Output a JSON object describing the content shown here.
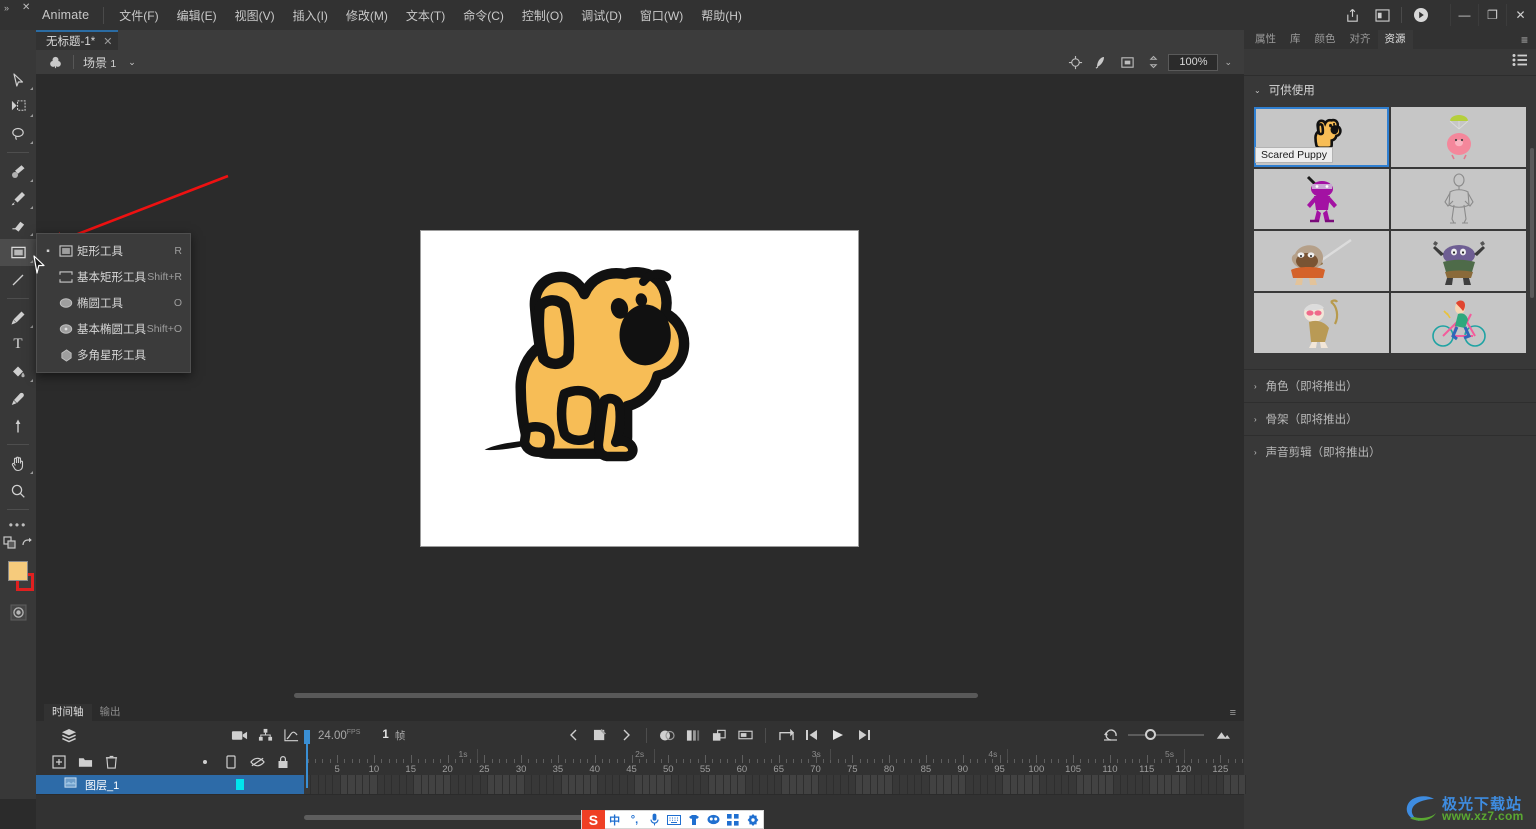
{
  "titlebar": {
    "app_name": "Animate",
    "menus": [
      "文件(F)",
      "编辑(E)",
      "视图(V)",
      "插入(I)",
      "修改(M)",
      "文本(T)",
      "命令(C)",
      "控制(O)",
      "调试(D)",
      "窗口(W)",
      "帮助(H)"
    ],
    "share_icon": "share-icon",
    "workspace_icon": "workspace-layout-icon",
    "play_icon": "play-preview-icon",
    "minimize": "—",
    "maximize": "❐",
    "close": "✕"
  },
  "document": {
    "tab_title": "无标题-1*",
    "tab_close": "✕"
  },
  "editbar": {
    "scene_icon": "scene-icon",
    "scene_label": "场景",
    "scene_number": "1",
    "caret": "⌄",
    "center_icon": "center-stage-icon",
    "rotate_icon": "rotate-stage-icon",
    "clip_icon": "clip-content-icon",
    "stepper_icon": "stage-stepper-icon",
    "zoom_value": "100%",
    "zoom_caret": "⌄"
  },
  "toolbar": {
    "tools": [
      {
        "name": "selection-tool",
        "glyph": "arrow"
      },
      {
        "name": "free-transform-tool",
        "glyph": "transform"
      },
      {
        "name": "lasso-tool",
        "glyph": "lasso"
      },
      {
        "name": "paintbrush-tool",
        "glyph": "brush-fluid"
      },
      {
        "name": "brush-tool",
        "glyph": "brush"
      },
      {
        "name": "eraser-tool",
        "glyph": "eraser"
      },
      {
        "name": "rectangle-tool",
        "glyph": "rectangle"
      },
      {
        "name": "line-tool",
        "glyph": "line"
      },
      {
        "name": "pen-tool",
        "glyph": "pen"
      },
      {
        "name": "text-tool",
        "glyph": "T"
      },
      {
        "name": "paint-bucket-tool",
        "glyph": "bucket"
      },
      {
        "name": "eyedropper-tool",
        "glyph": "eyedropper"
      },
      {
        "name": "width-tool",
        "glyph": "pin"
      },
      {
        "name": "hand-tool",
        "glyph": "hand"
      },
      {
        "name": "zoom-tool",
        "glyph": "magnifier"
      }
    ],
    "more_dots": "•••",
    "swap_colors_icon": "swap-colors-icon",
    "reset_colors_icon": "reset-colors-icon",
    "fill_color": "#f6cb7c",
    "stroke_color": "#e02020",
    "object_draw_icon": "object-drawing-icon"
  },
  "tool_menu": {
    "items": [
      {
        "label": "矩形工具",
        "key": "R",
        "icon": "rectangle-icon",
        "selected": true
      },
      {
        "label": "基本矩形工具",
        "key": "Shift+R",
        "icon": "primitive-rectangle-icon",
        "selected": false
      },
      {
        "label": "椭圆工具",
        "key": "O",
        "icon": "oval-icon",
        "selected": false
      },
      {
        "label": "基本椭圆工具",
        "key": "Shift+O",
        "icon": "primitive-oval-icon",
        "selected": false
      },
      {
        "label": "多角星形工具",
        "key": "",
        "icon": "polystar-icon",
        "selected": false
      }
    ]
  },
  "rightpanel": {
    "tabs": [
      {
        "label": "属性",
        "active": false
      },
      {
        "label": "库",
        "active": false
      },
      {
        "label": "颜色",
        "active": false
      },
      {
        "label": "对齐",
        "active": false
      },
      {
        "label": "资源",
        "active": true
      }
    ],
    "panel_menu_icon": "panel-menu-icon",
    "list_view_icon": "list-view-icon",
    "available_section": {
      "caret": "⌄",
      "title": "可供使用"
    },
    "assets": [
      {
        "name": "Scared Puppy",
        "kind": "puppy",
        "selected": true,
        "tooltip": "Scared Puppy"
      },
      {
        "name": "parachute-pig",
        "kind": "pig",
        "selected": false,
        "tooltip": ""
      },
      {
        "name": "purple-ninja",
        "kind": "ninja",
        "selected": false,
        "tooltip": ""
      },
      {
        "name": "wireframe-figure",
        "kind": "wire",
        "selected": false,
        "tooltip": ""
      },
      {
        "name": "sword-warrior",
        "kind": "warrior",
        "selected": false,
        "tooltip": ""
      },
      {
        "name": "gun-creature",
        "kind": "creature",
        "selected": false,
        "tooltip": ""
      },
      {
        "name": "golf-grandpa",
        "kind": "golfer",
        "selected": false,
        "tooltip": ""
      },
      {
        "name": "cyclist-girl",
        "kind": "cyclist",
        "selected": false,
        "tooltip": ""
      }
    ],
    "coming_soon": [
      {
        "caret": "›",
        "label": "角色（即将推出）"
      },
      {
        "caret": "›",
        "label": "骨架（即将推出）"
      },
      {
        "caret": "›",
        "label": "声音剪辑（即将推出）"
      }
    ]
  },
  "timeline": {
    "tabs": [
      {
        "label": "时间轴",
        "active": true
      },
      {
        "label": "输出",
        "active": false
      }
    ],
    "panel_menu_icon": "timeline-menu-icon",
    "layers_icon": "layers-stack-icon",
    "camera_icon": "camera-icon",
    "parent_view_icon": "parent-view-icon",
    "graph_icon": "graph-editor-icon",
    "fps_value": "24.00",
    "fps_unit": "FPS",
    "current_frame": "1",
    "frame_unit": "帧",
    "controls": [
      {
        "name": "prev-keyframe-button",
        "glyph": "‹"
      },
      {
        "name": "insert-keyframe-button",
        "glyph": "kf"
      },
      {
        "name": "next-keyframe-button",
        "glyph": "›"
      },
      {
        "name": "onion-skin-button",
        "glyph": "onion"
      },
      {
        "name": "onion-skin-outlines-button",
        "glyph": "onion-outline"
      },
      {
        "name": "edit-multiple-frames-button",
        "glyph": "multi"
      },
      {
        "name": "modify-onion-markers-button",
        "glyph": "markers"
      },
      {
        "name": "loop-range-button",
        "glyph": "loop-range"
      },
      {
        "name": "step-back-button",
        "glyph": "◀|"
      },
      {
        "name": "play-button",
        "glyph": "▶"
      },
      {
        "name": "step-forward-button",
        "glyph": "|▶"
      }
    ],
    "loop_icon": "loop-playback-icon",
    "resize_icon": "resize-frames-icon",
    "add_layer_icon": "add-layer-icon",
    "add_folder_icon": "new-folder-icon",
    "delete_layer_icon": "delete-layer-icon",
    "dot_icon": "layer-dot-icon",
    "mobile_icon": "layer-mobile-icon",
    "eye_icon": "hide-layer-icon",
    "lock_icon": "lock-layer-icon",
    "ruler": {
      "frame_labels": [
        5,
        10,
        15,
        20,
        25,
        30,
        35,
        40,
        45,
        50,
        55,
        60,
        65,
        70,
        75,
        80,
        85,
        90,
        95,
        100,
        105,
        110,
        115,
        120,
        125
      ],
      "second_labels": [
        "1s",
        "2s",
        "3s",
        "4s",
        "5s"
      ],
      "second_frames": [
        24,
        48,
        72,
        96,
        120
      ]
    },
    "layers": [
      {
        "name": "图层_1",
        "icon": "layer-icon",
        "selected": true,
        "outline_color": "#00e5ee"
      }
    ]
  },
  "ime": {
    "logo": "S",
    "items": [
      "中",
      "°,",
      "mic-icon",
      "keyboard-icon",
      "skin-icon",
      "emoji-icon",
      "apps-icon",
      "tools-icon"
    ]
  },
  "watermark": {
    "line1": "极光下载站",
    "line2": "www.xz7.com"
  }
}
